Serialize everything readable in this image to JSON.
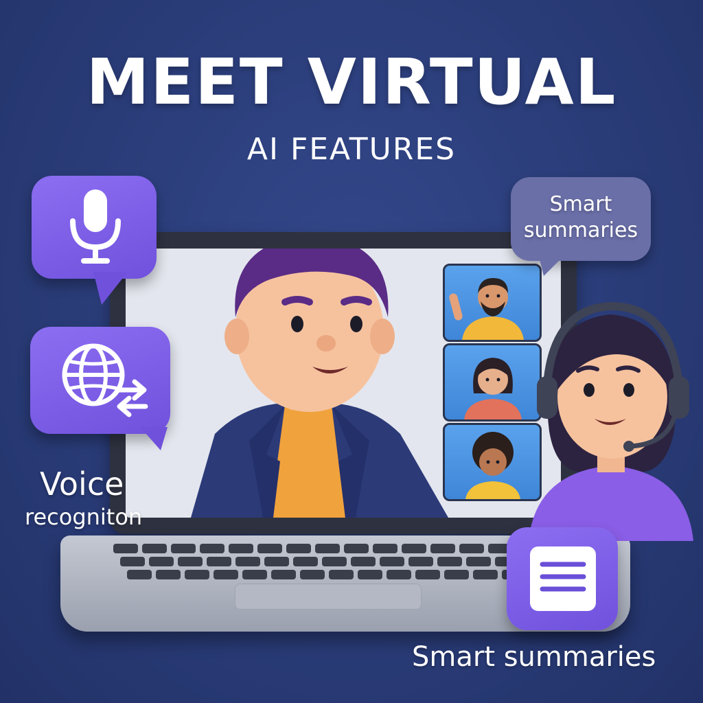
{
  "header": {
    "title": "MEET VIRTUAL",
    "subtitle": "AI FEATURES"
  },
  "features": {
    "voice": {
      "label_line1": "Voice",
      "label_line2": "recogniton",
      "icon": "microphone-icon"
    },
    "translate": {
      "icon": "globe-translate-icon"
    },
    "summary_chip": {
      "line1": "Smart",
      "line2": "summaries"
    },
    "summary_card": {
      "label": "Smart summaries",
      "icon": "document-lines-icon"
    }
  },
  "colors": {
    "background": "#2a3c78",
    "bubble": "#7b5ce6",
    "chip": "#6a6fa8",
    "host_shirt": "#f0a23c",
    "host_jacket": "#2c3a78",
    "agent_shirt": "#8a5ee6"
  },
  "participants": [
    {
      "name": "participant-waving",
      "shirt": "#f2b83a"
    },
    {
      "name": "participant-woman",
      "shirt": "#e2725b"
    },
    {
      "name": "participant-curly",
      "shirt": "#f2c23a"
    }
  ]
}
